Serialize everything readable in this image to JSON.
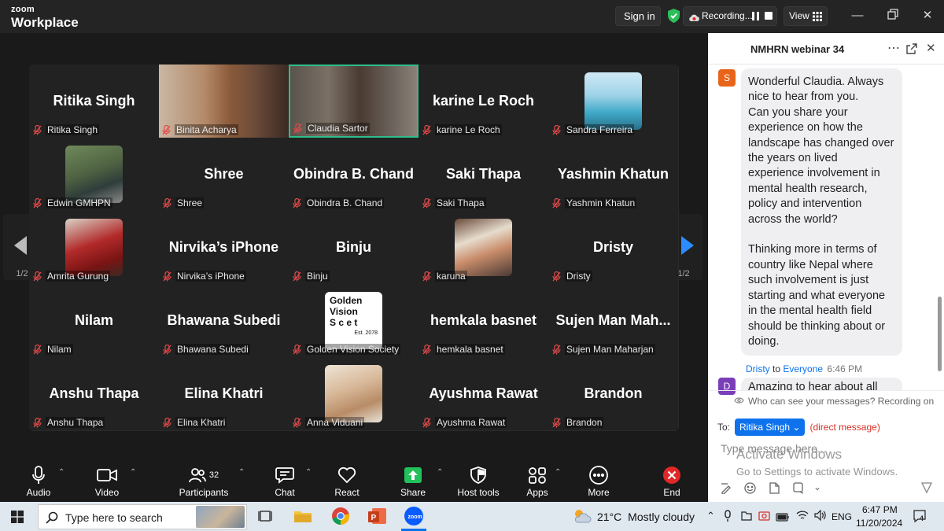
{
  "app": {
    "logo_top": "zoom",
    "logo_bottom": "Workplace"
  },
  "titlebar": {
    "sign_in": "Sign in",
    "recording": "Recording...",
    "view": "View"
  },
  "gallery": {
    "page_left": "1/2",
    "page_right": "1/2",
    "tiles": [
      {
        "big": "Ritika Singh",
        "label": "Ritika Singh",
        "kind": "name"
      },
      {
        "big": "",
        "label": "Binita Acharya",
        "kind": "video"
      },
      {
        "big": "",
        "label": "Claudia Sartor",
        "kind": "video"
      },
      {
        "big": "karine Le Roch",
        "label": "karine Le Roch",
        "kind": "name"
      },
      {
        "big": "",
        "label": "Sandra Ferreira",
        "kind": "thumb"
      },
      {
        "big": "",
        "label": "Edwin GMHPN",
        "kind": "thumb"
      },
      {
        "big": "Shree",
        "label": "Shree",
        "kind": "name"
      },
      {
        "big": "Obindra B. Chand",
        "label": "Obindra B. Chand",
        "kind": "name"
      },
      {
        "big": "Saki Thapa",
        "label": "Saki Thapa",
        "kind": "name"
      },
      {
        "big": "Yashmin Khatun",
        "label": "Yashmin Khatun",
        "kind": "name"
      },
      {
        "big": "",
        "label": "Amrita Gurung",
        "kind": "thumb"
      },
      {
        "big": "Nirvika’s iPhone",
        "label": "Nirvika’s iPhone",
        "kind": "name"
      },
      {
        "big": "Binju",
        "label": "Binju",
        "kind": "name"
      },
      {
        "big": "",
        "label": "karuna",
        "kind": "thumb"
      },
      {
        "big": "Dristy",
        "label": "Dristy",
        "kind": "name"
      },
      {
        "big": "Nilam",
        "label": "Nilam",
        "kind": "name"
      },
      {
        "big": "Bhawana Subedi",
        "label": "Bhawana Subedi",
        "kind": "name"
      },
      {
        "big": "",
        "label": "Golden Vision Society",
        "kind": "logo"
      },
      {
        "big": "hemkala basnet",
        "label": "hemkala basnet",
        "kind": "name"
      },
      {
        "big": "Sujen Man Mah...",
        "label": "Sujen Man Maharjan",
        "kind": "name"
      },
      {
        "big": "Anshu Thapa",
        "label": "Anshu Thapa",
        "kind": "name"
      },
      {
        "big": "Elina Khatri",
        "label": "Elina Khatri",
        "kind": "name"
      },
      {
        "big": "",
        "label": "Anna Viduani",
        "kind": "thumb"
      },
      {
        "big": "Ayushma Rawat",
        "label": "Ayushma Rawat",
        "kind": "name"
      },
      {
        "big": "Brandon",
        "label": "Brandon",
        "kind": "name"
      }
    ],
    "logo_text": {
      "l1": "Golden",
      "l2": "Vision",
      "l3": "S c e t",
      "l4": "Est. 2078"
    }
  },
  "toolbar": {
    "audio": "Audio",
    "video": "Video",
    "participants": "Participants",
    "participants_count": "32",
    "chat": "Chat",
    "react": "React",
    "share": "Share",
    "host_tools": "Host tools",
    "apps": "Apps",
    "more": "More",
    "end": "End"
  },
  "chat": {
    "title": "NMHRN webinar 34",
    "avatar_s": "S",
    "message": "Wonderful Claudia. Always nice to hear from you.\nCan you share your experience on how the landscape has changed over the years on lived experience involvement in mental health research, policy and intervention across the world?\n\nThinking more in terms of country like Nepal where such involvement is just starting and what everyone in the mental health field should be thinking about or doing.",
    "next_sender": "Dristy",
    "next_to": "to",
    "next_target": "Everyone",
    "next_time": "6:46 PM",
    "avatar_d": "D",
    "next_preview": "Amazing to hear about all",
    "notice": "Who can see your messages? Recording on",
    "to_label": "To:",
    "to_recipient": "Ritika Singh",
    "direct": "(direct message)",
    "placeholder": "Type message here...",
    "watermark_title": "Activate Windows",
    "watermark_sub": "Go to Settings to activate Windows."
  },
  "taskbar": {
    "search_placeholder": "Type here to search",
    "weather_temp": "21°C",
    "weather_desc": "Mostly cloudy",
    "lang": "ENG",
    "time": "6:47 PM",
    "date": "11/20/2024",
    "notif_count": "4"
  },
  "colors": {
    "accent": "#0e72ed",
    "active_speaker": "#2dbe8a",
    "end_red": "#e02828",
    "share_green": "#23c15c",
    "avatar_s": "#e8641b",
    "avatar_d": "#7a3fb8"
  }
}
